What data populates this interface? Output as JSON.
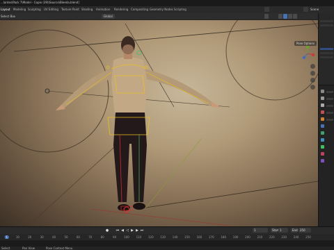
{
  "window": {
    "title": "...lantes\\Pack 7\\Model - Copie (39)\\Source\\Bleeda.blend]"
  },
  "workspace_tabs": [
    {
      "label": "Layout",
      "active": true
    },
    {
      "label": "Modeling",
      "active": false
    },
    {
      "label": "Sculpting",
      "active": false
    },
    {
      "label": "UV Editing",
      "active": false
    },
    {
      "label": "Texture Paint",
      "active": false
    },
    {
      "label": "Shading",
      "active": false
    },
    {
      "label": "Animation",
      "active": false
    },
    {
      "label": "Rendering",
      "active": false
    },
    {
      "label": "Compositing",
      "active": false
    },
    {
      "label": "Geometry Nodes",
      "active": false
    },
    {
      "label": "Scripting",
      "active": false
    }
  ],
  "scene": {
    "label": "Scene"
  },
  "viewport_header": {
    "mode": "Select Box",
    "orientation": "Global",
    "pose_options": "Pose Options"
  },
  "timeline": {
    "ticks": [
      "0",
      "10",
      "20",
      "30",
      "40",
      "50",
      "60",
      "70",
      "80",
      "90",
      "100",
      "110",
      "120",
      "130",
      "140",
      "150",
      "160",
      "170",
      "180",
      "190",
      "200",
      "210",
      "220",
      "230",
      "240",
      "250"
    ],
    "current_frame": "1",
    "start_label": "Start",
    "start_value": "1",
    "end_label": "End",
    "end_value": "250"
  },
  "status_bar": {
    "select": "Select",
    "pan_view": "Pan View",
    "context_menu": "Pose Context Menu"
  },
  "colors": {
    "accent": "#4772b3",
    "bone_yellow": "#e8c020",
    "bone_green": "#40c060",
    "bone_red": "#e03030"
  },
  "icons": [
    "move-icon",
    "rotate-icon",
    "zoom-icon",
    "camera-icon",
    "grid-icon",
    "play-icon",
    "jump-start-icon",
    "jump-end-icon",
    "record-icon"
  ]
}
